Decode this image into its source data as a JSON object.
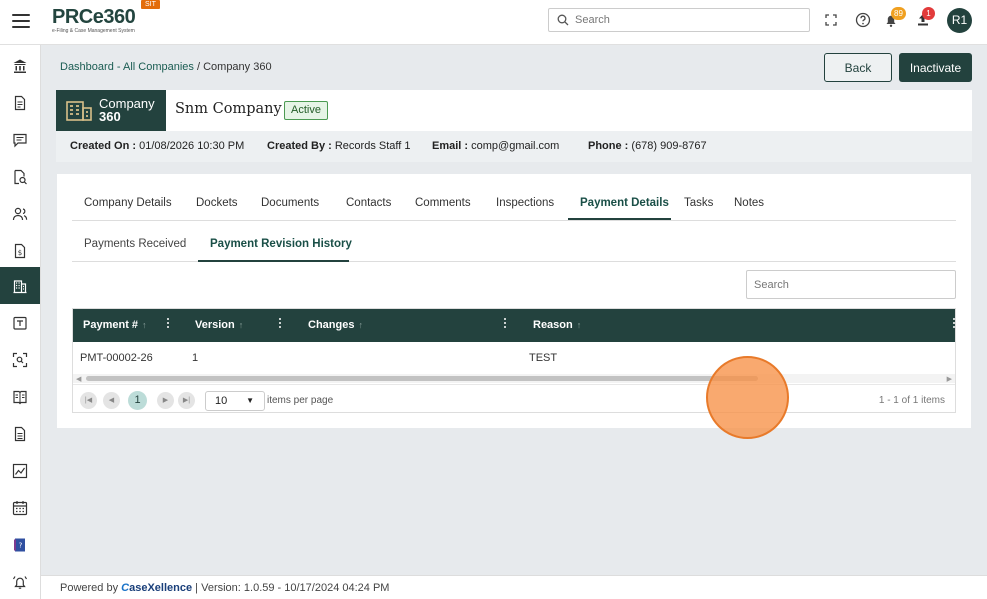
{
  "header": {
    "logo_text": "PRCe360",
    "logo_subtitle": "e-Filing & Case Management System",
    "env_badge": "SIT",
    "search_placeholder": "Search",
    "notifications_count": "89",
    "uploads_count": "1",
    "user_initials": "R1",
    "icons": [
      "menu-icon",
      "search-icon",
      "fullscreen-icon",
      "help-icon",
      "bell-icon",
      "upload-icon"
    ]
  },
  "sidebar": {
    "icons": [
      "bank-icon",
      "document-icon",
      "comment-icon",
      "document-search-icon",
      "users-icon",
      "fee-document-icon",
      "building-icon",
      "calendar-task-icon",
      "scan-icon",
      "book-icon",
      "file-icon",
      "chart-icon",
      "calendar-icon",
      "help-book-icon",
      "alarm-icon"
    ],
    "active_index": 6
  },
  "breadcrumb": {
    "link": "Dashboard - All Companies",
    "separator": "/",
    "current": "Company 360"
  },
  "actions": {
    "back_label": "Back",
    "inactivate_label": "Inactivate"
  },
  "company": {
    "tag_line1": "Company",
    "tag_line2": "360",
    "name": "Snm Company",
    "status": "Active"
  },
  "info": {
    "created_on_label": "Created On :",
    "created_on": "01/08/2026 10:30 PM",
    "created_by_label": "Created By :",
    "created_by": "Records Staff 1",
    "email_label": "Email :",
    "email": "comp@gmail.com",
    "phone_label": "Phone :",
    "phone": "(678) 909-8767"
  },
  "tabs": [
    "Company Details",
    "Dockets",
    "Documents",
    "Contacts",
    "Comments",
    "Inspections",
    "Payment Details",
    "Tasks",
    "Notes"
  ],
  "active_tab": "Payment Details",
  "subtabs": [
    "Payments Received",
    "Payment Revision History"
  ],
  "active_subtab": "Payment Revision History",
  "grid": {
    "search_placeholder": "Search",
    "columns": [
      "Payment #",
      "Version",
      "Changes",
      "Reason"
    ],
    "rows": [
      {
        "payment": "PMT-00002-26",
        "version": "1",
        "changes": "",
        "reason": "TEST"
      }
    ],
    "pager": {
      "current_page": "1",
      "page_size": "10",
      "page_size_label": "items per page",
      "info": "1 - 1 of 1 items"
    }
  },
  "footer": {
    "powered_by": "Powered by",
    "brand_mark": "C",
    "brand": "aseXellence",
    "separator": "|",
    "version": "Version: 1.0.59 - 10/17/2024 04:24 PM"
  },
  "colors": {
    "primary": "#23423e",
    "accent_orange": "#e36c0a",
    "active_badge_bg": "#e6f4e6",
    "notification_orange": "#f0a020",
    "notification_red": "#e23b3b"
  }
}
